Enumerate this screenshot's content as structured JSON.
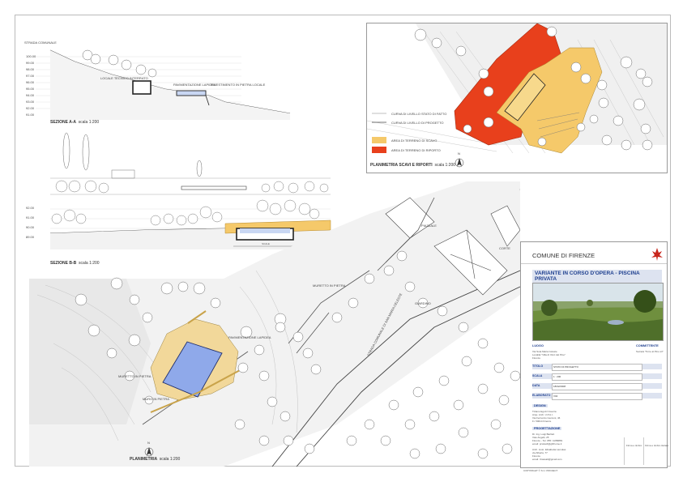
{
  "sezione_aa": {
    "title": "SEZIONE A-A",
    "scale": "scala 1:200",
    "labels": {
      "strada_comunale": "STRADA COMUNALE",
      "locale_tecnico": "LOCALE TECNICO INTERRATO",
      "pavimentazione": "PAVIMENTAZIONE LAPIDEA",
      "rivestimento": "RIVESTIMENTO IN PIETRA LOCALE"
    },
    "levels": [
      "100.00",
      "99.00",
      "98.00",
      "97.00",
      "96.00",
      "95.00",
      "94.00",
      "93.00",
      "92.00",
      "91.00"
    ]
  },
  "sezione_bb": {
    "title": "SEZIONE B-B",
    "scale": "scala 1:200",
    "levels": [
      "92.00",
      "91.00",
      "90.00",
      "89.00"
    ]
  },
  "planimetria_scavi": {
    "title": "PLANIMETRIA SCAVI E RIPORTI",
    "scale": "scala 1:200",
    "north": "N",
    "legend": [
      {
        "label": "CURVA DI LIVELLO STATO DI FATTO",
        "kind": "line-gray"
      },
      {
        "label": "CURVA DI LIVELLO DI PROGETTO",
        "kind": "line-dark"
      },
      {
        "label": "AREA DI TERRENO DI SCAVO",
        "kind": "fill",
        "color": "#f5c96a"
      },
      {
        "label": "AREA DI TERRENO DI RIPORTO",
        "kind": "fill",
        "color": "#e8401c"
      }
    ]
  },
  "planimetria": {
    "title": "PLANIMETRIA",
    "scale": "scala 1:200",
    "north": "N",
    "labels": {
      "pavimentazione": "PAVIMENTAZIONE LAPIDEA",
      "muretto_pietra": "MURETTO IN PIETRA",
      "muro_pietra": "MURO IN PIETRA",
      "muretto_pietra_top": "MURETTO IN PIETRA",
      "strada": "STRADA COMUNALE DI SAN MARIA CELESTE",
      "giardino": "GIARDINO",
      "piazzale": "PIAZZALE",
      "corte": "CORTE"
    }
  },
  "cartouche": {
    "comune": "COMUNE DI FIRENZE",
    "titolo_progetto": "VARIANTE IN CORSO D'OPERA - PISCINA PRIVATA",
    "luogo_label": "LUOGO",
    "luogo_lines": [
      "Via Sota Maria Celeste",
      "Località \"Villa di Vinci del Pino\"",
      "Firenze"
    ],
    "committente_label": "COMMITTENTE",
    "committente_lines": [
      "Società \"Torre al Pino srl\""
    ],
    "fields": [
      {
        "label": "TITOLO",
        "value": "STATO DI PROGETTO"
      },
      {
        "label": "SCALA",
        "value": "1 : 200"
      },
      {
        "label": "DATA",
        "value": "18/02/2008"
      },
      {
        "label": "ELABORATO",
        "value": "V02"
      }
    ],
    "design_label": "DESIGN",
    "design_lines": [
      "Tiziano Eguzzi Guerra",
      "Arqu. Arch. U.P.A.I.",
      "Via Ferruccio Cecconi, 46",
      "Fi. 50014 Firenze"
    ],
    "progettazione_label": "PROGETTAZIONE",
    "progettazione_lines": [
      "Dr. Ing. Luigi Bartlett",
      "Vias Angelli, 25",
      "Firenze - Tel. 055 / 2289881",
      "email: prsisteft@gfirhome.it"
    ],
    "collab_lines": [
      "Arch. Liuto. Elisabetta Lamulas",
      "via Alberia, 77",
      "Firenze",
      "email: l.bassalt@gmail.com"
    ],
    "firma_label_1": "Firma e timbro",
    "firma_label_2": "Firma e timbro titolare",
    "copyright": "COPYRIGHT © S.U. PROJECT"
  }
}
